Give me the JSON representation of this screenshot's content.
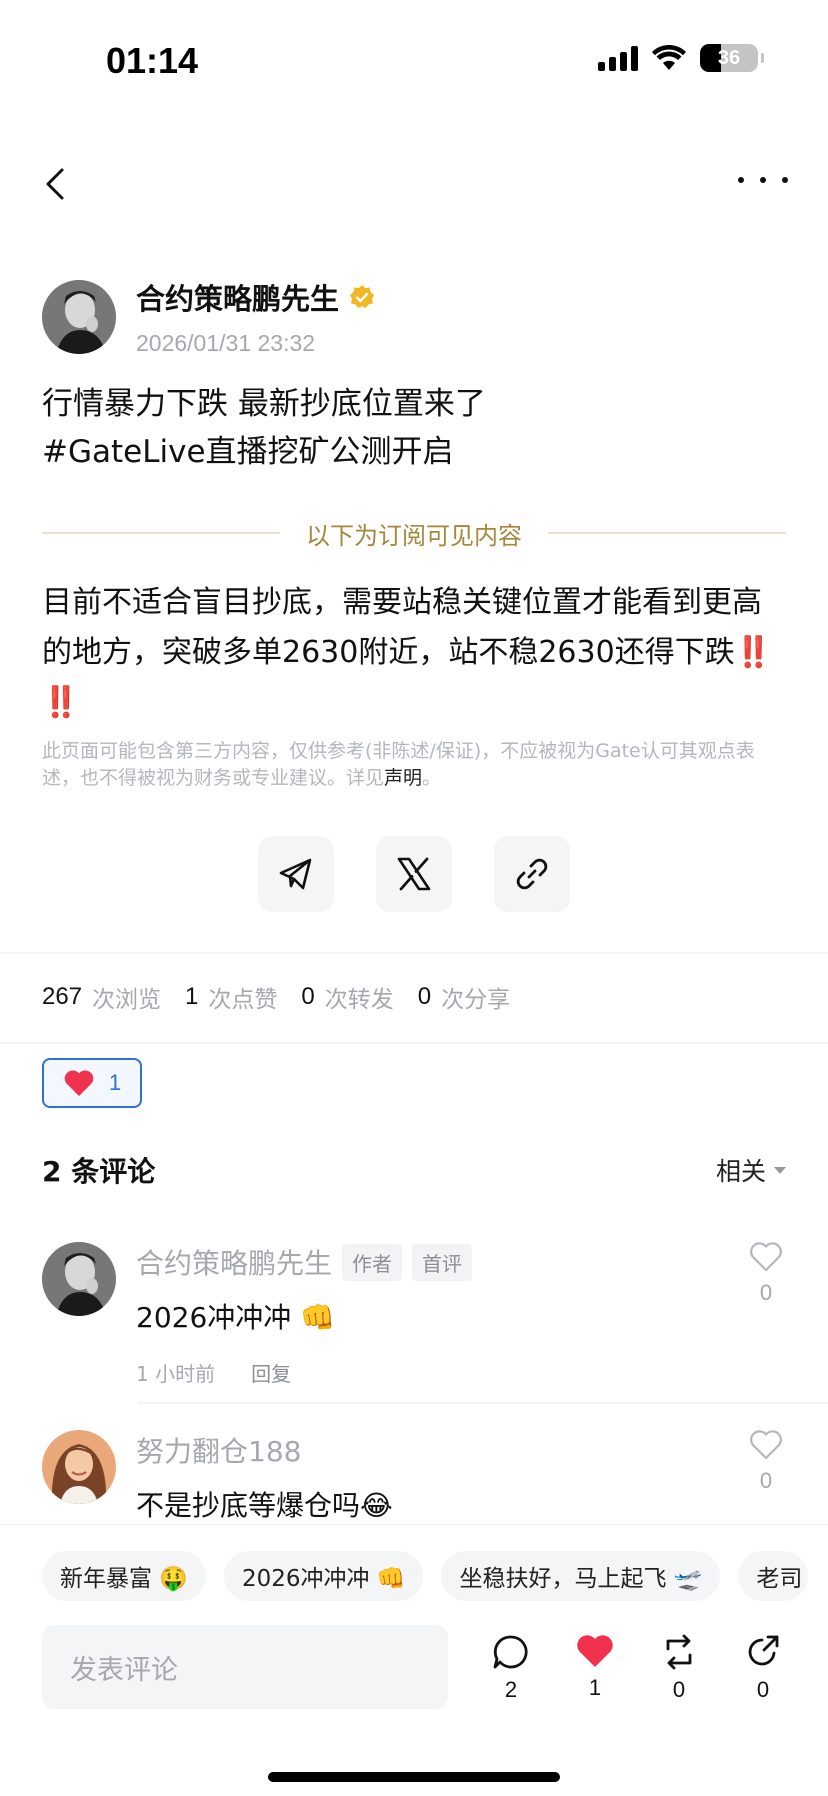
{
  "status_bar": {
    "time": "01:14",
    "battery": "36"
  },
  "post": {
    "author": "合约策略鹏先生",
    "timestamp": "2026/01/31 23:32",
    "text_line1": "行情暴力下跌 最新抄底位置来了",
    "text_line2": "#GateLive直播挖矿公测开启",
    "subscribe_divider": "以下为订阅可见内容",
    "subscriber_text": "目前不适合盲目抄底，需要站稳关键位置才能看到更高的地方，突破多单2630附近，站不稳2630还得下跌",
    "bang1": "‼️",
    "bang2": "‼️",
    "disclaimer": "此页面可能包含第三方内容，仅供参考(非陈述/保证)，不应被视为Gate认可其观点表述，也不得被视为财务或专业建议。详见",
    "disclaimer_link": "声明",
    "disclaimer_end": "。"
  },
  "share_buttons": [
    "telegram-icon",
    "x-icon",
    "link-icon"
  ],
  "stats": [
    {
      "value": "267",
      "label": "次浏览"
    },
    {
      "value": "1",
      "label": "次点赞"
    },
    {
      "value": "0",
      "label": "次转发"
    },
    {
      "value": "0",
      "label": "次分享"
    }
  ],
  "like_chip": {
    "count": "1"
  },
  "comments_section": {
    "title": "2 条评论",
    "sort_label": "相关",
    "items": [
      {
        "name": "合约策略鹏先生",
        "tags": [
          "作者",
          "首评"
        ],
        "text": "2026冲冲冲 👊",
        "time": "1 小时前",
        "reply": "回复",
        "likes": "0"
      },
      {
        "name": "努力翻仓188",
        "text": "不是抄底等爆仓吗😂",
        "likes": "0"
      }
    ]
  },
  "quick_replies": [
    "新年暴富 🤑",
    "2026冲冲冲 👊",
    "坐稳扶好，马上起飞 🛫",
    "老司"
  ],
  "bottom_bar": {
    "input_placeholder": "发表评论",
    "comment_count": "2",
    "like_count": "1",
    "repost_count": "0",
    "share_count": "0"
  },
  "colors": {
    "accent_blue": "#2f6fde",
    "gold": "#a7863a",
    "heart_red": "#f0324c"
  }
}
